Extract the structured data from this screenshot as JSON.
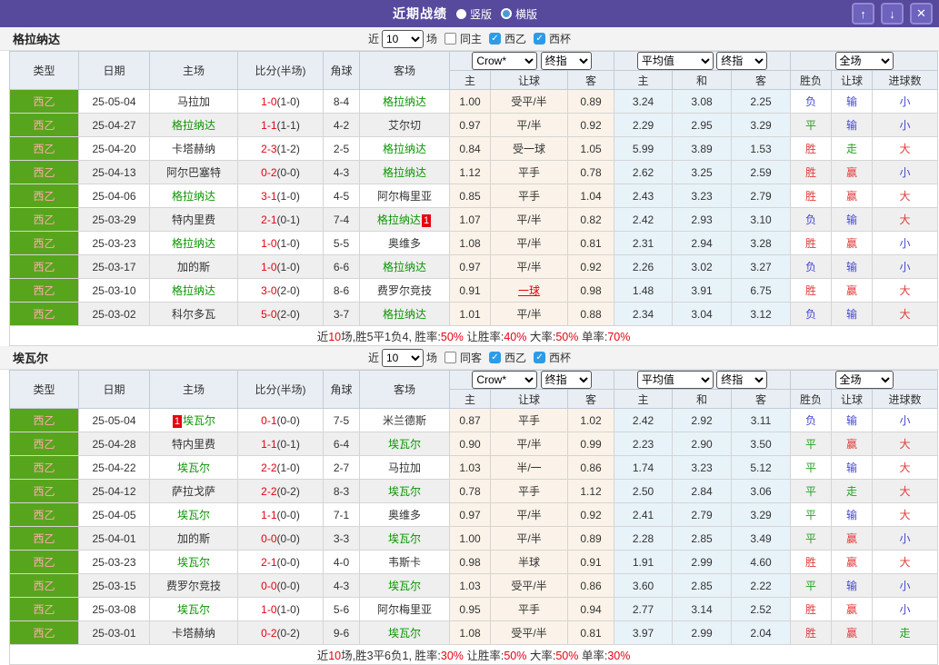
{
  "icons": {
    "check": "✓",
    "up_arrow": "↑",
    "down_arrow": "↓",
    "close": "✕"
  },
  "colors": {
    "titlebar_purple": "#57499c",
    "button_purple": "#6d62bc",
    "league_green": "#57a51d",
    "league_text_pink": "#ffacac",
    "focal_team_green": "#0a9600",
    "score_red": "#e60012",
    "result_red": "#e23b3b",
    "result_blue": "#4747d1",
    "result_green": "#23a123",
    "handicap_bg": "#fbf3e9",
    "average_bg": "#e8f2f9",
    "header_bg": "#e9eef4",
    "checkbox_blue": "#2d9ce8"
  },
  "titlebar": {
    "title": "近期战绩",
    "layout_radios": [
      {
        "label": "竖版",
        "selected": true
      },
      {
        "label": "横版",
        "selected": false
      }
    ]
  },
  "table_header": {
    "static_columns": [
      "类型",
      "日期",
      "主场",
      "比分(半场)",
      "角球",
      "客场"
    ],
    "groups": [
      {
        "selects": [
          "Crow*",
          "终指"
        ],
        "columns": [
          "主",
          "让球",
          "客"
        ]
      },
      {
        "selects": [
          "平均值",
          "终指"
        ],
        "columns": [
          "主",
          "和",
          "客"
        ]
      },
      {
        "selects": [
          "全场"
        ],
        "columns": [
          "胜负",
          "让球",
          "进球数"
        ]
      }
    ]
  },
  "tables": [
    {
      "team": "格拉纳达",
      "filter": {
        "near_label": "近",
        "count": "10",
        "matches_label": "场",
        "checkboxes": [
          {
            "label": "同主",
            "checked": false
          },
          {
            "label": "西乙",
            "checked": true
          },
          {
            "label": "西杯",
            "checked": true
          }
        ]
      },
      "rows": [
        {
          "league": "西乙",
          "date": "25-05-04",
          "home": "马拉加",
          "home_focal": false,
          "home_badge": "",
          "score": "1-0",
          "half": "(1-0)",
          "corner": "8-4",
          "away": "格拉纳达",
          "away_focal": true,
          "away_badge": "",
          "hcp_home": "1.00",
          "hcp_line": "受平/半",
          "hcp_hot": false,
          "hcp_away": "0.89",
          "avg_home": "3.24",
          "avg_draw": "3.08",
          "avg_away": "2.25",
          "res_wdl": "负",
          "res_hcp": "输",
          "res_ou": "小"
        },
        {
          "league": "西乙",
          "date": "25-04-27",
          "home": "格拉纳达",
          "home_focal": true,
          "home_badge": "",
          "score": "1-1",
          "half": "(1-1)",
          "corner": "4-2",
          "away": "艾尔切",
          "away_focal": false,
          "away_badge": "",
          "hcp_home": "0.97",
          "hcp_line": "平/半",
          "hcp_hot": false,
          "hcp_away": "0.92",
          "avg_home": "2.29",
          "avg_draw": "2.95",
          "avg_away": "3.29",
          "res_wdl": "平",
          "res_hcp": "输",
          "res_ou": "小"
        },
        {
          "league": "西乙",
          "date": "25-04-20",
          "home": "卡塔赫纳",
          "home_focal": false,
          "home_badge": "",
          "score": "2-3",
          "half": "(1-2)",
          "corner": "2-5",
          "away": "格拉纳达",
          "away_focal": true,
          "away_badge": "",
          "hcp_home": "0.84",
          "hcp_line": "受一球",
          "hcp_hot": false,
          "hcp_away": "1.05",
          "avg_home": "5.99",
          "avg_draw": "3.89",
          "avg_away": "1.53",
          "res_wdl": "胜",
          "res_hcp": "走",
          "res_ou": "大"
        },
        {
          "league": "西乙",
          "date": "25-04-13",
          "home": "阿尔巴塞特",
          "home_focal": false,
          "home_badge": "",
          "score": "0-2",
          "half": "(0-0)",
          "corner": "4-3",
          "away": "格拉纳达",
          "away_focal": true,
          "away_badge": "",
          "hcp_home": "1.12",
          "hcp_line": "平手",
          "hcp_hot": false,
          "hcp_away": "0.78",
          "avg_home": "2.62",
          "avg_draw": "3.25",
          "avg_away": "2.59",
          "res_wdl": "胜",
          "res_hcp": "赢",
          "res_ou": "小"
        },
        {
          "league": "西乙",
          "date": "25-04-06",
          "home": "格拉纳达",
          "home_focal": true,
          "home_badge": "",
          "score": "3-1",
          "half": "(1-0)",
          "corner": "4-5",
          "away": "阿尔梅里亚",
          "away_focal": false,
          "away_badge": "",
          "hcp_home": "0.85",
          "hcp_line": "平手",
          "hcp_hot": false,
          "hcp_away": "1.04",
          "avg_home": "2.43",
          "avg_draw": "3.23",
          "avg_away": "2.79",
          "res_wdl": "胜",
          "res_hcp": "赢",
          "res_ou": "大"
        },
        {
          "league": "西乙",
          "date": "25-03-29",
          "home": "特内里费",
          "home_focal": false,
          "home_badge": "",
          "score": "2-1",
          "half": "(0-1)",
          "corner": "7-4",
          "away": "格拉纳达",
          "away_focal": true,
          "away_badge": "1",
          "hcp_home": "1.07",
          "hcp_line": "平/半",
          "hcp_hot": false,
          "hcp_away": "0.82",
          "avg_home": "2.42",
          "avg_draw": "2.93",
          "avg_away": "3.10",
          "res_wdl": "负",
          "res_hcp": "输",
          "res_ou": "大"
        },
        {
          "league": "西乙",
          "date": "25-03-23",
          "home": "格拉纳达",
          "home_focal": true,
          "home_badge": "",
          "score": "1-0",
          "half": "(1-0)",
          "corner": "5-5",
          "away": "奥维多",
          "away_focal": false,
          "away_badge": "",
          "hcp_home": "1.08",
          "hcp_line": "平/半",
          "hcp_hot": false,
          "hcp_away": "0.81",
          "avg_home": "2.31",
          "avg_draw": "2.94",
          "avg_away": "3.28",
          "res_wdl": "胜",
          "res_hcp": "赢",
          "res_ou": "小"
        },
        {
          "league": "西乙",
          "date": "25-03-17",
          "home": "加的斯",
          "home_focal": false,
          "home_badge": "",
          "score": "1-0",
          "half": "(1-0)",
          "corner": "6-6",
          "away": "格拉纳达",
          "away_focal": true,
          "away_badge": "",
          "hcp_home": "0.97",
          "hcp_line": "平/半",
          "hcp_hot": false,
          "hcp_away": "0.92",
          "avg_home": "2.26",
          "avg_draw": "3.02",
          "avg_away": "3.27",
          "res_wdl": "负",
          "res_hcp": "输",
          "res_ou": "小"
        },
        {
          "league": "西乙",
          "date": "25-03-10",
          "home": "格拉纳达",
          "home_focal": true,
          "home_badge": "",
          "score": "3-0",
          "half": "(2-0)",
          "corner": "8-6",
          "away": "费罗尔竞技",
          "away_focal": false,
          "away_badge": "",
          "hcp_home": "0.91",
          "hcp_line": "一球",
          "hcp_hot": true,
          "hcp_away": "0.98",
          "avg_home": "1.48",
          "avg_draw": "3.91",
          "avg_away": "6.75",
          "res_wdl": "胜",
          "res_hcp": "赢",
          "res_ou": "大"
        },
        {
          "league": "西乙",
          "date": "25-03-02",
          "home": "科尔多瓦",
          "home_focal": false,
          "home_badge": "",
          "score": "5-0",
          "half": "(2-0)",
          "corner": "3-7",
          "away": "格拉纳达",
          "away_focal": true,
          "away_badge": "",
          "hcp_home": "1.01",
          "hcp_line": "平/半",
          "hcp_hot": false,
          "hcp_away": "0.88",
          "avg_home": "2.34",
          "avg_draw": "3.04",
          "avg_away": "3.12",
          "res_wdl": "负",
          "res_hcp": "输",
          "res_ou": "大"
        }
      ],
      "summary": [
        {
          "text": "近",
          "red": false
        },
        {
          "text": "10",
          "red": true
        },
        {
          "text": "场,胜5平1负4, 胜率:",
          "red": false
        },
        {
          "text": "50%",
          "red": true
        },
        {
          "text": " 让胜率:",
          "red": false
        },
        {
          "text": "40%",
          "red": true
        },
        {
          "text": " 大率:",
          "red": false
        },
        {
          "text": "50%",
          "red": true
        },
        {
          "text": " 单率:",
          "red": false
        },
        {
          "text": "70%",
          "red": true
        }
      ]
    },
    {
      "team": "埃瓦尔",
      "filter": {
        "near_label": "近",
        "count": "10",
        "matches_label": "场",
        "checkboxes": [
          {
            "label": "同客",
            "checked": false
          },
          {
            "label": "西乙",
            "checked": true
          },
          {
            "label": "西杯",
            "checked": true
          }
        ]
      },
      "rows": [
        {
          "league": "西乙",
          "date": "25-05-04",
          "home": "埃瓦尔",
          "home_focal": true,
          "home_badge": "1",
          "score": "0-1",
          "half": "(0-0)",
          "corner": "7-5",
          "away": "米兰德斯",
          "away_focal": false,
          "away_badge": "",
          "hcp_home": "0.87",
          "hcp_line": "平手",
          "hcp_hot": false,
          "hcp_away": "1.02",
          "avg_home": "2.42",
          "avg_draw": "2.92",
          "avg_away": "3.11",
          "res_wdl": "负",
          "res_hcp": "输",
          "res_ou": "小"
        },
        {
          "league": "西乙",
          "date": "25-04-28",
          "home": "特内里费",
          "home_focal": false,
          "home_badge": "",
          "score": "1-1",
          "half": "(0-1)",
          "corner": "6-4",
          "away": "埃瓦尔",
          "away_focal": true,
          "away_badge": "",
          "hcp_home": "0.90",
          "hcp_line": "平/半",
          "hcp_hot": false,
          "hcp_away": "0.99",
          "avg_home": "2.23",
          "avg_draw": "2.90",
          "avg_away": "3.50",
          "res_wdl": "平",
          "res_hcp": "赢",
          "res_ou": "大"
        },
        {
          "league": "西乙",
          "date": "25-04-22",
          "home": "埃瓦尔",
          "home_focal": true,
          "home_badge": "",
          "score": "2-2",
          "half": "(1-0)",
          "corner": "2-7",
          "away": "马拉加",
          "away_focal": false,
          "away_badge": "",
          "hcp_home": "1.03",
          "hcp_line": "半/一",
          "hcp_hot": false,
          "hcp_away": "0.86",
          "avg_home": "1.74",
          "avg_draw": "3.23",
          "avg_away": "5.12",
          "res_wdl": "平",
          "res_hcp": "输",
          "res_ou": "大"
        },
        {
          "league": "西乙",
          "date": "25-04-12",
          "home": "萨拉戈萨",
          "home_focal": false,
          "home_badge": "",
          "score": "2-2",
          "half": "(0-2)",
          "corner": "8-3",
          "away": "埃瓦尔",
          "away_focal": true,
          "away_badge": "",
          "hcp_home": "0.78",
          "hcp_line": "平手",
          "hcp_hot": false,
          "hcp_away": "1.12",
          "avg_home": "2.50",
          "avg_draw": "2.84",
          "avg_away": "3.06",
          "res_wdl": "平",
          "res_hcp": "走",
          "res_ou": "大"
        },
        {
          "league": "西乙",
          "date": "25-04-05",
          "home": "埃瓦尔",
          "home_focal": true,
          "home_badge": "",
          "score": "1-1",
          "half": "(0-0)",
          "corner": "7-1",
          "away": "奥维多",
          "away_focal": false,
          "away_badge": "",
          "hcp_home": "0.97",
          "hcp_line": "平/半",
          "hcp_hot": false,
          "hcp_away": "0.92",
          "avg_home": "2.41",
          "avg_draw": "2.79",
          "avg_away": "3.29",
          "res_wdl": "平",
          "res_hcp": "输",
          "res_ou": "大"
        },
        {
          "league": "西乙",
          "date": "25-04-01",
          "home": "加的斯",
          "home_focal": false,
          "home_badge": "",
          "score": "0-0",
          "half": "(0-0)",
          "corner": "3-3",
          "away": "埃瓦尔",
          "away_focal": true,
          "away_badge": "",
          "hcp_home": "1.00",
          "hcp_line": "平/半",
          "hcp_hot": false,
          "hcp_away": "0.89",
          "avg_home": "2.28",
          "avg_draw": "2.85",
          "avg_away": "3.49",
          "res_wdl": "平",
          "res_hcp": "赢",
          "res_ou": "小"
        },
        {
          "league": "西乙",
          "date": "25-03-23",
          "home": "埃瓦尔",
          "home_focal": true,
          "home_badge": "",
          "score": "2-1",
          "half": "(0-0)",
          "corner": "4-0",
          "away": "韦斯卡",
          "away_focal": false,
          "away_badge": "",
          "hcp_home": "0.98",
          "hcp_line": "半球",
          "hcp_hot": false,
          "hcp_away": "0.91",
          "avg_home": "1.91",
          "avg_draw": "2.99",
          "avg_away": "4.60",
          "res_wdl": "胜",
          "res_hcp": "赢",
          "res_ou": "大"
        },
        {
          "league": "西乙",
          "date": "25-03-15",
          "home": "费罗尔竞技",
          "home_focal": false,
          "home_badge": "",
          "score": "0-0",
          "half": "(0-0)",
          "corner": "4-3",
          "away": "埃瓦尔",
          "away_focal": true,
          "away_badge": "",
          "hcp_home": "1.03",
          "hcp_line": "受平/半",
          "hcp_hot": false,
          "hcp_away": "0.86",
          "avg_home": "3.60",
          "avg_draw": "2.85",
          "avg_away": "2.22",
          "res_wdl": "平",
          "res_hcp": "输",
          "res_ou": "小"
        },
        {
          "league": "西乙",
          "date": "25-03-08",
          "home": "埃瓦尔",
          "home_focal": true,
          "home_badge": "",
          "score": "1-0",
          "half": "(1-0)",
          "corner": "5-6",
          "away": "阿尔梅里亚",
          "away_focal": false,
          "away_badge": "",
          "hcp_home": "0.95",
          "hcp_line": "平手",
          "hcp_hot": false,
          "hcp_away": "0.94",
          "avg_home": "2.77",
          "avg_draw": "3.14",
          "avg_away": "2.52",
          "res_wdl": "胜",
          "res_hcp": "赢",
          "res_ou": "小"
        },
        {
          "league": "西乙",
          "date": "25-03-01",
          "home": "卡塔赫纳",
          "home_focal": false,
          "home_badge": "",
          "score": "0-2",
          "half": "(0-2)",
          "corner": "9-6",
          "away": "埃瓦尔",
          "away_focal": true,
          "away_badge": "",
          "hcp_home": "1.08",
          "hcp_line": "受平/半",
          "hcp_hot": false,
          "hcp_away": "0.81",
          "avg_home": "3.97",
          "avg_draw": "2.99",
          "avg_away": "2.04",
          "res_wdl": "胜",
          "res_hcp": "赢",
          "res_ou": "走"
        }
      ],
      "summary": [
        {
          "text": "近",
          "red": false
        },
        {
          "text": "10",
          "red": true
        },
        {
          "text": "场,胜3平6负1, 胜率:",
          "red": false
        },
        {
          "text": "30%",
          "red": true
        },
        {
          "text": " 让胜率:",
          "red": false
        },
        {
          "text": "50%",
          "red": true
        },
        {
          "text": " 大率:",
          "red": false
        },
        {
          "text": "50%",
          "red": true
        },
        {
          "text": " 单率:",
          "red": false
        },
        {
          "text": "30%",
          "red": true
        }
      ]
    }
  ]
}
